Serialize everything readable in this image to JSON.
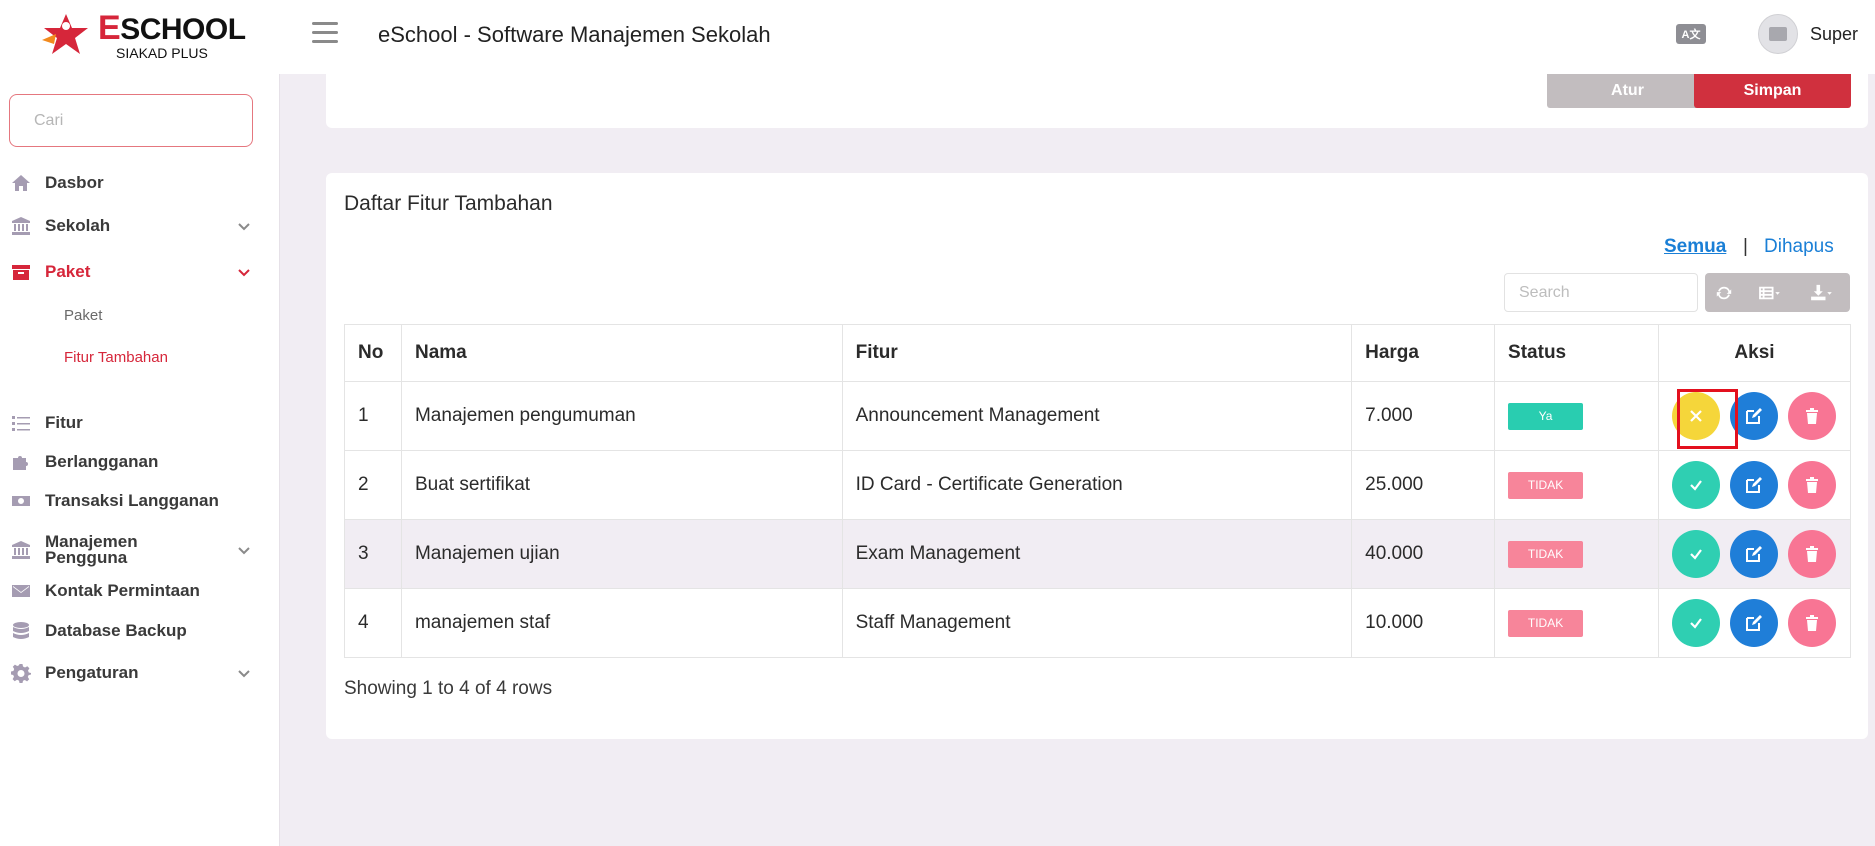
{
  "header": {
    "logo_main": "SCHOOL",
    "logo_letter": "E",
    "logo_sub": "SIAKAD PLUS",
    "title": "eSchool - Software Manajemen Sekolah",
    "lang_icon": "A文",
    "user_name": "Super"
  },
  "sidebar": {
    "search_placeholder": "Cari",
    "items": [
      {
        "label": "Dasbor",
        "icon": "home-icon"
      },
      {
        "label": "Sekolah",
        "icon": "bank-icon"
      },
      {
        "label": "Paket",
        "icon": "archive-icon"
      },
      {
        "label": "Fitur",
        "icon": "list-icon"
      },
      {
        "label": "Berlangganan",
        "icon": "puzzle-icon"
      },
      {
        "label": "Transaksi Langganan",
        "icon": "money-icon"
      },
      {
        "label": "Manajemen Pengguna",
        "icon": "bank-icon"
      },
      {
        "label": "Kontak Permintaan",
        "icon": "envelope-icon"
      },
      {
        "label": "Database Backup",
        "icon": "database-icon"
      },
      {
        "label": "Pengaturan",
        "icon": "gear-icon"
      }
    ],
    "sub_items": [
      {
        "label": "Paket"
      },
      {
        "label": "Fitur Tambahan"
      }
    ]
  },
  "top_card": {
    "atur_label": "Atur",
    "simpan_label": "Simpan"
  },
  "main": {
    "card_title": "Daftar Fitur Tambahan",
    "filter_all": "Semua",
    "filter_sep": "|",
    "filter_deleted": "Dihapus",
    "search_placeholder": "Search",
    "columns": [
      "No",
      "Nama",
      "Fitur",
      "Harga",
      "Status",
      "Aksi"
    ],
    "rows": [
      {
        "no": "1",
        "nama": "Manajemen pengumuman",
        "fitur": "Announcement Management",
        "harga": "7.000",
        "status": "Ya"
      },
      {
        "no": "2",
        "nama": "Buat sertifikat",
        "fitur": "ID Card - Certificate Generation",
        "harga": "25.000",
        "status": "TIDAK"
      },
      {
        "no": "3",
        "nama": "Manajemen ujian",
        "fitur": "Exam Management",
        "harga": "40.000",
        "status": "TIDAK"
      },
      {
        "no": "4",
        "nama": "manajemen staf",
        "fitur": "Staff Management",
        "harga": "10.000",
        "status": "TIDAK"
      }
    ],
    "footer": "Showing 1 to 4 of 4 rows"
  },
  "colors": {
    "accent": "#d6263a",
    "link": "#1a7fd6",
    "status_yes": "#29cdb0",
    "status_no": "#f7859a",
    "action_check": "#2fcfb2",
    "action_cross": "#f5d63a",
    "action_edit": "#1f7ed8",
    "action_delete": "#f87594"
  }
}
